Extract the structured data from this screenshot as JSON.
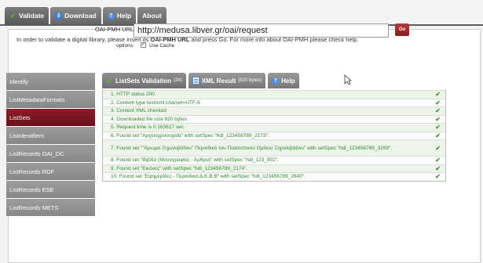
{
  "nav": {
    "tabs": [
      {
        "label": "Validate",
        "icon": "check-icon"
      },
      {
        "label": "Download",
        "icon": "download-icon"
      },
      {
        "label": "Help",
        "icon": "help-icon"
      },
      {
        "label": "About",
        "icon": ""
      }
    ]
  },
  "intro": {
    "before": "In order to validate a digital library, please insert its ",
    "strong": "OAI-PMH URL",
    "after": " and press Go. For more info about OAI-PMH please check help."
  },
  "form": {
    "url_label": "OAI-PMH URL:",
    "url_value": "http://medusa.libver.gr/oai/request",
    "go_label": "Go",
    "options_label": "options:",
    "use_cache_label": "Use Cache",
    "use_cache_checked": true
  },
  "sidebar": {
    "items": [
      {
        "label": "Identify"
      },
      {
        "label": "ListMetadataFormats"
      },
      {
        "label": "ListSets",
        "active": true
      },
      {
        "label": "ListIdentifiers"
      },
      {
        "label": "ListRecords OAI_DC"
      },
      {
        "label": "ListRecords RDF"
      },
      {
        "label": "ListRecords ESE"
      },
      {
        "label": "ListRecords METS"
      }
    ]
  },
  "result_tabs": [
    {
      "label": "ListSets Validation",
      "count": "(24)",
      "icon": "check-icon"
    },
    {
      "label": "XML Result",
      "count": "(820 bytes)",
      "icon": "document-icon"
    },
    {
      "label": "Help",
      "count": "",
      "icon": "help-icon"
    }
  ],
  "results": [
    "1. HTTP status 200",
    "2. Content type text/xml;charset=UTF-8",
    "3. Content XML checked",
    "4. Downloaded file size 820 bytes",
    "5. Request time is 0.163617 sec",
    "6. Found set \"Αρχειοχρυσοχοΐα\" with setSpec \"hdl_123456789_2173\".",
    "7. Found set \"\"Άρωμα Ξηρολιβάδου\" Περιοδικό του Πολιτιστικού Ομίλου Ξηρολιβάδου\" with setSpec \"hdl_123456789_3209\".",
    "8. Found set \"Βιβλία (Μονογραφίες - Άρθρα)\" with setSpec \"hdl_123_902\".",
    "9. Found set \"Εικόνες\" with setSpec \"hdl_123456789_2174\".",
    "10. Found set \"Εφημερίδες - Περιοδικά Δ.Κ.Β.Β\" with setSpec \"hdl_123456789_2640\"."
  ],
  "colors": {
    "active_nav": "#6b0f18",
    "success_text": "#2e8b2e",
    "go_button": "#8a1e1e"
  }
}
